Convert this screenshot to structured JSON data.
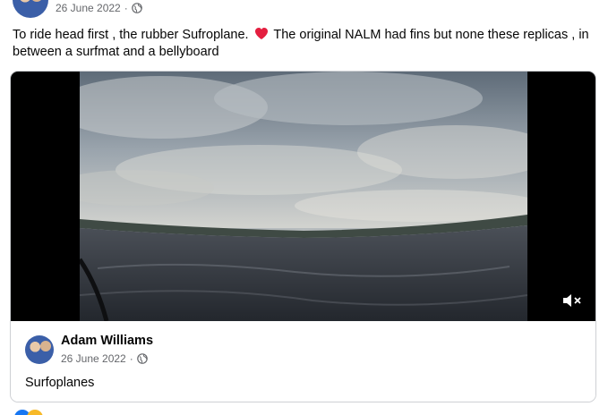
{
  "post": {
    "timestamp": "26 June 2022",
    "separator": "·",
    "privacy_icon": "globe-icon",
    "text_part1": "To ride head first , the rubber Sufroplane.",
    "emoji": "heart-icon",
    "text_part2": "The original NALM had fins but none these replicas , in between a surfmat and a bellyboard"
  },
  "shared": {
    "video": {
      "muted_icon": "speaker-muted-icon"
    },
    "author": "Adam Williams",
    "timestamp": "26 June 2022",
    "separator": "·",
    "privacy_icon": "globe-icon",
    "caption": "Surfoplanes"
  },
  "colors": {
    "text": "#050505",
    "secondary_text": "#65676b",
    "border": "#ced0d4",
    "heart": "#e41e3f"
  }
}
